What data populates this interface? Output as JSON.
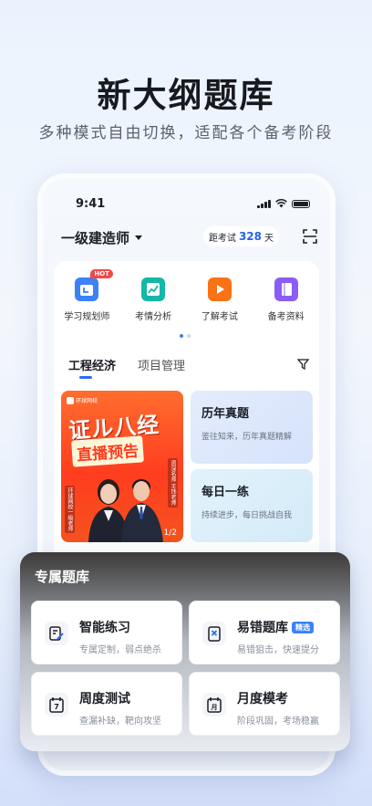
{
  "headline": "新大纲题库",
  "subline": "多种模式自由切换，适配各个备考阶段",
  "status": {
    "time": "9:41"
  },
  "topbar": {
    "exam_name": "一级建造师",
    "countdown_prefix": "距考试",
    "countdown_days": "328",
    "countdown_unit": "天"
  },
  "quick_actions": [
    {
      "label": "学习规划师",
      "icon": "calendar-plan-icon",
      "badge": "HOT",
      "color": "#3b82f6"
    },
    {
      "label": "考情分析",
      "icon": "trend-chart-icon",
      "color": "#14b8a6"
    },
    {
      "label": "了解考试",
      "icon": "play-video-icon",
      "color": "#f97316"
    },
    {
      "label": "备考资料",
      "icon": "book-icon",
      "color": "#8b5cf6"
    }
  ],
  "subject_tabs": [
    "工程经济",
    "项目管理"
  ],
  "banner": {
    "brand": "环球网校",
    "title_line1": "证ル八经",
    "title_line2": "直播预告",
    "pager": "1/2",
    "tag_left": "环球网校一级老师",
    "tag_right": "资深名师 王玮老师"
  },
  "feature_cards": [
    {
      "title": "历年真题",
      "subtitle": "鉴往知来，历年真题精解"
    },
    {
      "title": "每日一练",
      "subtitle": "持续进步，每日挑战自我"
    }
  ],
  "exclusive": {
    "title": "专属题库",
    "tiles": [
      {
        "title": "智能练习",
        "subtitle": "专属定制，弱点绝杀",
        "icon": "edit-note-icon"
      },
      {
        "title": "易错题库",
        "subtitle": "易错狙击，快速提分",
        "icon": "error-book-icon",
        "badge": "精选"
      },
      {
        "title": "周度测试",
        "subtitle": "查漏补缺，靶向攻坚",
        "icon": "calendar-7-icon",
        "icon_text": "7"
      },
      {
        "title": "月度模考",
        "subtitle": "阶段巩固，考场稳赢",
        "icon": "calendar-month-icon",
        "icon_text": "月"
      }
    ]
  },
  "colors": {
    "accent": "#2e6cf6",
    "hot": "#f04848",
    "banner": "#ff3d1f"
  }
}
